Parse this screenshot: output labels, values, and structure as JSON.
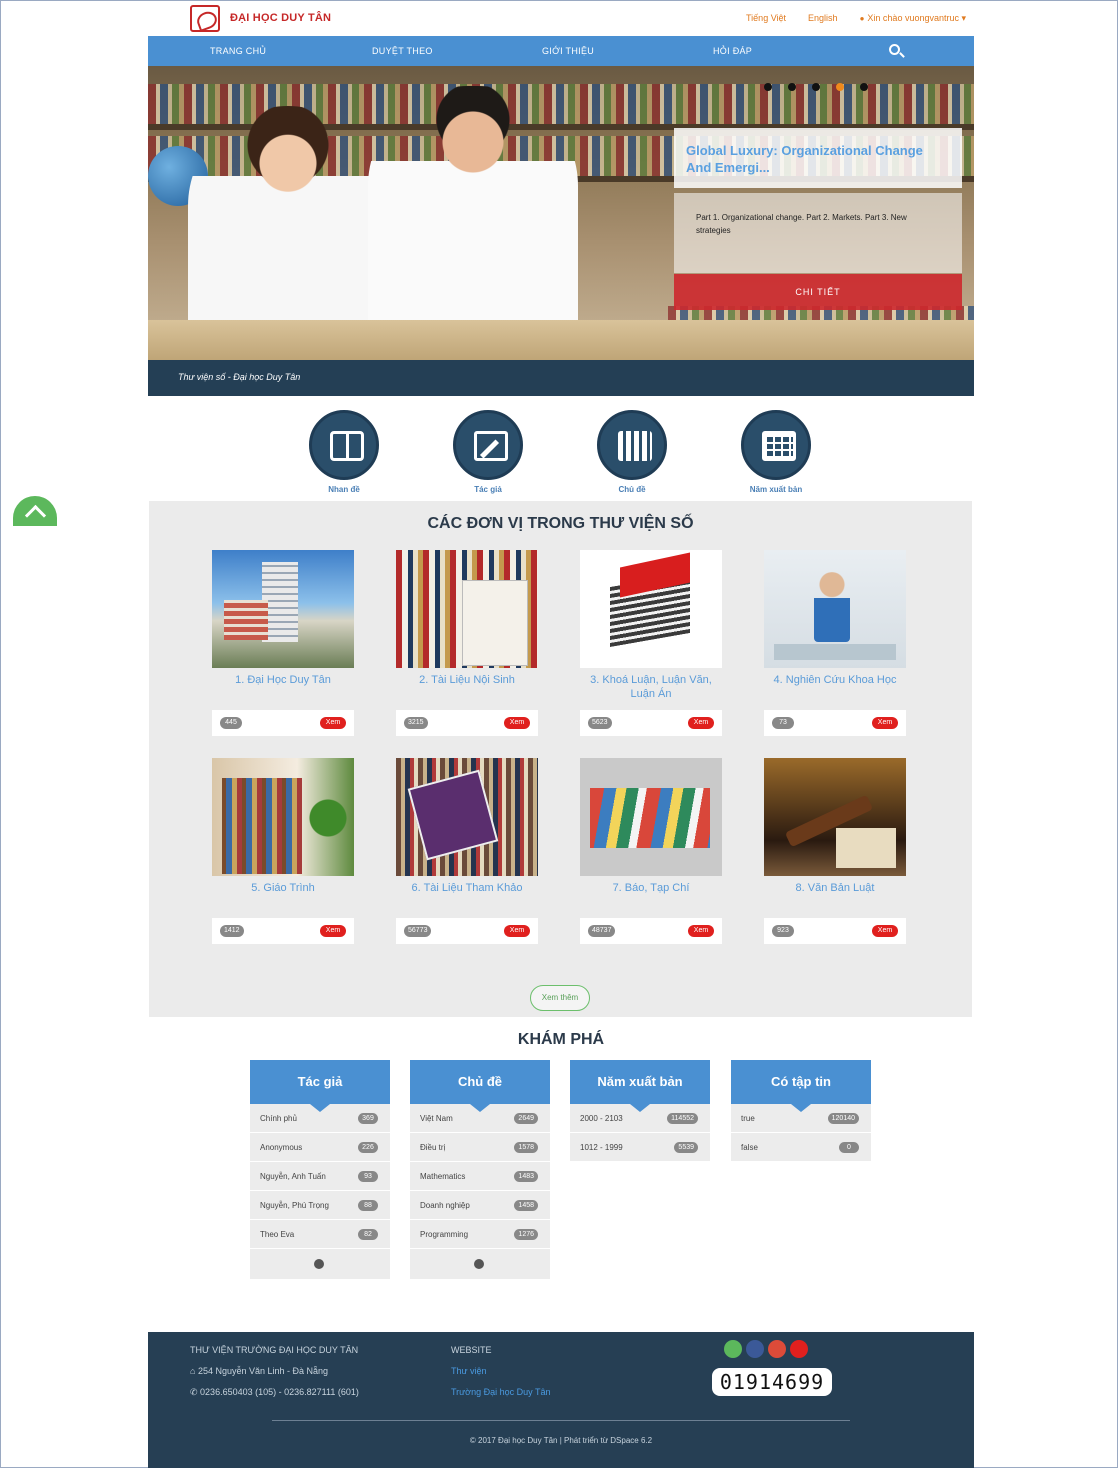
{
  "header": {
    "brand": "ĐẠI HỌC DUY TÂN",
    "lang_vi": "Tiếng Việt",
    "lang_en": "English",
    "user_greeting": "Xin chào vuongvantruc ▾"
  },
  "nav": {
    "items": [
      "TRANG CHỦ",
      "DUYỆT THEO",
      "GIỚI THIỆU",
      "HỎI ĐÁP"
    ]
  },
  "hero": {
    "title": "Global Luxury: Organizational Change And Emergi...",
    "description": "Part 1. Organizational change. Part 2. Markets. Part 3. New strategies",
    "detail_button": "CHI TIẾT",
    "caption": "Thư viện số - Đại học Duy Tân",
    "active_slide": 4,
    "slide_count": 5
  },
  "browse": {
    "items": [
      {
        "label": "Nhan đề",
        "icon": "book-icon"
      },
      {
        "label": "Tác giả",
        "icon": "edit-icon"
      },
      {
        "label": "Chủ đề",
        "icon": "books-icon"
      },
      {
        "label": "Năm xuất bản",
        "icon": "calendar-icon"
      }
    ]
  },
  "units": {
    "title": "CÁC ĐƠN VỊ TRONG THƯ VIỆN SỐ",
    "view_label": "Xem",
    "see_more": "Xem thêm",
    "cards": [
      {
        "label": "1. Đại Học Duy Tân",
        "count": "445"
      },
      {
        "label": "2. Tài Liệu Nội Sinh",
        "count": "3215"
      },
      {
        "label": "3. Khoá Luận, Luận Văn, Luận Án",
        "count": "5623"
      },
      {
        "label": "4. Nghiên Cứu Khoa Học",
        "count": "73"
      },
      {
        "label": "5. Giáo Trình",
        "count": "1412"
      },
      {
        "label": "6. Tài Liệu Tham Khảo",
        "count": "56773"
      },
      {
        "label": "7. Báo, Tạp Chí",
        "count": "48737"
      },
      {
        "label": "8. Văn Bản Luật",
        "count": "923"
      }
    ]
  },
  "explore": {
    "title": "KHÁM PHÁ",
    "facets": [
      {
        "title": "Tác giả",
        "rows": [
          {
            "label": "Chính phủ",
            "count": "369"
          },
          {
            "label": "Anonymous",
            "count": "226"
          },
          {
            "label": "Nguyễn, Anh Tuấn",
            "count": "93"
          },
          {
            "label": "Nguyễn, Phú Trọng",
            "count": "88"
          },
          {
            "label": "Theo Eva",
            "count": "82"
          }
        ],
        "more": true
      },
      {
        "title": "Chủ đề",
        "rows": [
          {
            "label": "Việt Nam",
            "count": "2649"
          },
          {
            "label": "Điều trị",
            "count": "1578"
          },
          {
            "label": "Mathematics",
            "count": "1483"
          },
          {
            "label": "Doanh nghiệp",
            "count": "1458"
          },
          {
            "label": "Programming",
            "count": "1276"
          }
        ],
        "more": true
      },
      {
        "title": "Năm xuất bản",
        "rows": [
          {
            "label": "2000 - 2103",
            "count": "114552"
          },
          {
            "label": "1012 - 1999",
            "count": "5539"
          }
        ],
        "more": false
      },
      {
        "title": "Có tập tin",
        "rows": [
          {
            "label": "true",
            "count": "120140"
          },
          {
            "label": "false",
            "count": "0"
          }
        ],
        "more": false
      }
    ]
  },
  "footer": {
    "org": "THƯ VIỆN TRƯỜNG ĐẠI HỌC DUY TÂN",
    "address": "254 Nguyễn Văn Linh - Đà Nẵng",
    "phone": "0236.650403 (105) - 0236.827111 (601)",
    "website_heading": "WEBSITE",
    "link_library": "Thư viện",
    "link_university": "Trường Đại học Duy Tân",
    "visitor_counter": "01914699",
    "copyright": "© 2017 Đại học Duy Tân | Phát triển từ DSpace 6.2"
  },
  "colors": {
    "nav_blue": "#4a90d2",
    "footer_navy": "#263f54",
    "brand_red": "#c62828",
    "accent_orange": "#f08a1c",
    "view_red": "#e0201e"
  }
}
